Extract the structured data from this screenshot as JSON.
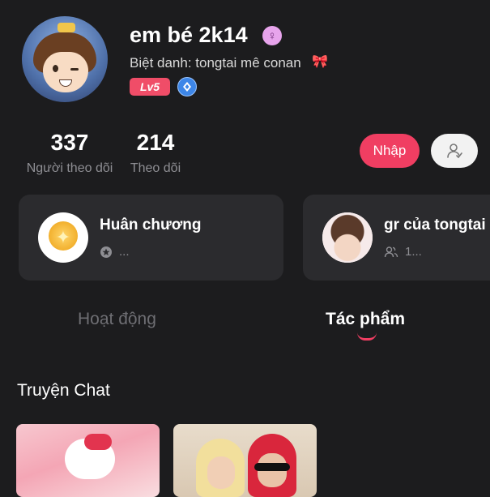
{
  "profile": {
    "username": "em bé 2k14",
    "gender_symbol": "♀",
    "nickname": "Biệt danh: tongtai mê conan",
    "nickname_emoji": "🎀",
    "level": "Lv5"
  },
  "stats": {
    "followers": {
      "value": "337",
      "label": "Người theo dõi"
    },
    "following": {
      "value": "214",
      "label": "Theo dõi"
    }
  },
  "actions": {
    "join_label": "Nhập"
  },
  "cards": [
    {
      "title": "Huân chương",
      "sub": "..."
    },
    {
      "title": "gr của tongtai",
      "sub": "1..."
    }
  ],
  "tabs": [
    {
      "label": "Hoạt động",
      "active": false
    },
    {
      "label": "Tác phẩm",
      "active": true
    }
  ],
  "section": {
    "title": "Truyện Chat"
  },
  "colors": {
    "background": "#1c1c1e",
    "accent": "#f03e62",
    "card": "#2b2b2e",
    "muted": "#8e8e93"
  }
}
